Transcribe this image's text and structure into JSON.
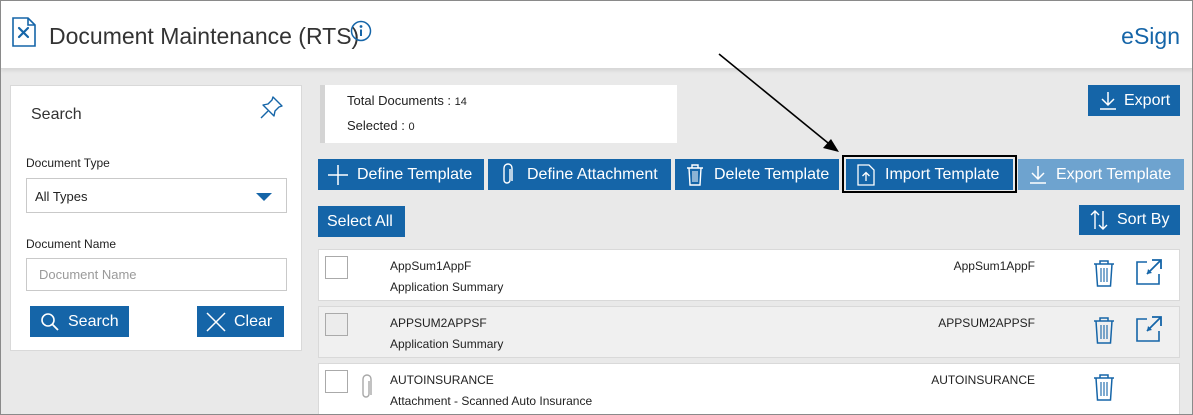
{
  "header": {
    "title": "Document Maintenance (RTS)",
    "product_link": "eSign",
    "icons": {
      "page": "document-tools-icon",
      "info": "info-icon"
    }
  },
  "search_panel": {
    "heading": "Search",
    "pin_icon": "pin-icon",
    "document_type_label": "Document Type",
    "document_type_value": "All Types",
    "document_name_label": "Document Name",
    "document_name_placeholder": "Document Name",
    "document_name_value": "",
    "search_button": "Search",
    "clear_button": "Clear"
  },
  "summary": {
    "total_label": "Total Documents :",
    "total_value": "14",
    "selected_label": "Selected :",
    "selected_value": "0"
  },
  "toolbar": {
    "export": "Export",
    "define_template": "Define Template",
    "define_attachment": "Define Attachment",
    "delete_template": "Delete Template",
    "import_template": "Import Template",
    "export_template": "Export Template",
    "select_all": "Select All",
    "sort_by": "Sort By"
  },
  "documents": [
    {
      "name": "AppSum1AppF",
      "description": "Application Summary",
      "code": "AppSum1AppF",
      "attachment": false,
      "has_open": true
    },
    {
      "name": "APPSUM2APPSF",
      "description": "Application Summary",
      "code": "APPSUM2APPSF",
      "attachment": false,
      "has_open": true
    },
    {
      "name": "AUTOINSURANCE",
      "description": "Attachment - Scanned Auto Insurance",
      "code": "AUTOINSURANCE",
      "attachment": true,
      "has_open": false
    }
  ],
  "colors": {
    "accent": "#1565a8",
    "disabled": "#6ea3cf",
    "background": "#e9e9e9"
  }
}
